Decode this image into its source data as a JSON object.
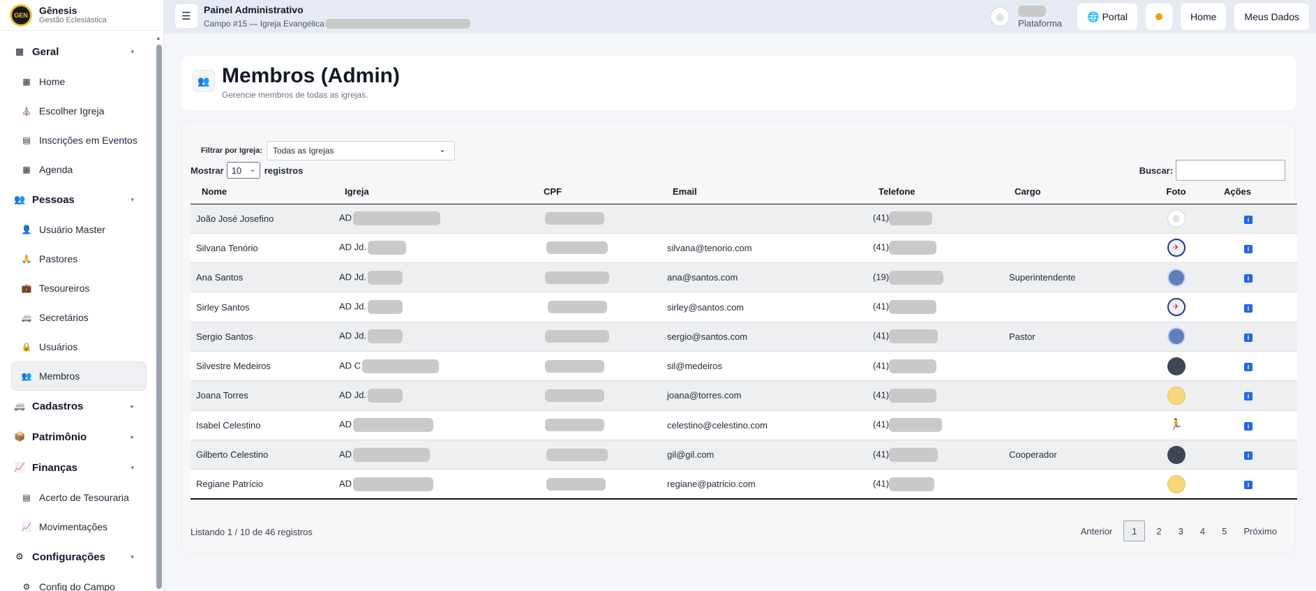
{
  "brand": {
    "name": "Gênesis",
    "subtitle": "Gestão Eclesiástica",
    "logo_text": "GEN"
  },
  "sidebar": {
    "sections": [
      {
        "label": "Geral",
        "icon": "grid-icon",
        "glyph": "▦",
        "caret": "▾",
        "items": [
          {
            "label": "Home",
            "icon": "grid-icon",
            "glyph": "▦"
          },
          {
            "label": "Escolher Igreja",
            "icon": "church-icon",
            "glyph": "⛪"
          },
          {
            "label": "Inscrições em Eventos",
            "icon": "document-icon",
            "glyph": "▤"
          },
          {
            "label": "Agenda",
            "icon": "calendar-icon",
            "glyph": "▦"
          }
        ]
      },
      {
        "label": "Pessoas",
        "icon": "people-icon",
        "glyph": "👥",
        "caret": "▾",
        "items": [
          {
            "label": "Usuário Master",
            "icon": "user-icon",
            "glyph": "👤"
          },
          {
            "label": "Pastores",
            "icon": "pastor-icon",
            "glyph": "🙏"
          },
          {
            "label": "Tesoureiros",
            "icon": "briefcase-icon",
            "glyph": "💼"
          },
          {
            "label": "Secretários",
            "icon": "vehicle-icon",
            "glyph": "🚐"
          },
          {
            "label": "Usuários",
            "icon": "lock-icon",
            "glyph": "🔒"
          },
          {
            "label": "Membros",
            "icon": "people-icon",
            "glyph": "👥",
            "active": true
          }
        ]
      },
      {
        "label": "Cadastros",
        "icon": "vehicle-icon",
        "glyph": "🚐",
        "caret": "▸",
        "items": []
      },
      {
        "label": "Patrimônio",
        "icon": "box-icon",
        "glyph": "📦",
        "caret": "▸",
        "items": []
      },
      {
        "label": "Finanças",
        "icon": "chart-icon",
        "glyph": "📈",
        "caret": "▾",
        "items": [
          {
            "label": "Acerto de Tesouraria",
            "icon": "document-icon",
            "glyph": "▤"
          },
          {
            "label": "Movimentações",
            "icon": "chart-icon",
            "glyph": "📈"
          }
        ]
      },
      {
        "label": "Configurações",
        "icon": "gear-icon",
        "glyph": "⚙",
        "caret": "▾",
        "items": [
          {
            "label": "Config do Campo",
            "icon": "gear-icon",
            "glyph": "⚙"
          }
        ]
      }
    ]
  },
  "topbar": {
    "title": "Painel Administrativo",
    "subtitle": "Campo #15 — Igreja Evangélica",
    "platform_label": "Plataforma",
    "portal_label": "Portal",
    "home_label": "Home",
    "my_data_label": "Meus Dados"
  },
  "header": {
    "title": "Membros (Admin)",
    "subtitle": "Gerencie membros de todas as igrejas."
  },
  "filter": {
    "label": "Filtrar por Igreja:",
    "selected": "Todas as Igrejas"
  },
  "length": {
    "prefix": "Mostrar",
    "selected": "10",
    "suffix": "registros"
  },
  "search": {
    "label": "Buscar:"
  },
  "table": {
    "columns": [
      "Nome",
      "Igreja",
      "CPF",
      "Email",
      "Telefone",
      "Cargo",
      "Foto",
      "Ações"
    ],
    "rows": [
      {
        "nome": "João José Josefino",
        "igreja": "AD",
        "email": "",
        "tel": "(41)",
        "cargo": "",
        "photo": "camera",
        "photo_color": "#ffffff"
      },
      {
        "nome": "Silvana Tenório",
        "igreja": "AD Jd.",
        "email": "silvana@tenorio.com",
        "tel": "(41)",
        "cargo": "",
        "photo": "emblem",
        "photo_color": "#eef1f8"
      },
      {
        "nome": "Ana Santos",
        "igreja": "AD Jd.",
        "email": "ana@santos.com",
        "tel": "(19)",
        "cargo": "Superintendente",
        "photo": "seal",
        "photo_color": "#5f7fb8"
      },
      {
        "nome": "Sirley Santos",
        "igreja": "AD Jd.",
        "email": "sirley@santos.com",
        "tel": "(41)",
        "cargo": "",
        "photo": "emblem",
        "photo_color": "#eef1f8"
      },
      {
        "nome": "Sergio Santos",
        "igreja": "AD Jd.",
        "email": "sergio@santos.com",
        "tel": "(41)",
        "cargo": "Pastor",
        "photo": "seal",
        "photo_color": "#5f7fb8"
      },
      {
        "nome": "Silvestre Medeiros",
        "igreja": "AD C",
        "email": "sil@medeiros",
        "tel": "(41)",
        "cargo": "",
        "photo": "dark",
        "photo_color": "#3f4756"
      },
      {
        "nome": "Joana Torres",
        "igreja": "AD Jd.",
        "email": "joana@torres.com",
        "tel": "(41)",
        "cargo": "",
        "photo": "cartoon",
        "photo_color": "#f6d77a"
      },
      {
        "nome": "Isabel Celestino",
        "igreja": "AD",
        "email": "celestino@celestino.com",
        "tel": "(41)",
        "cargo": "",
        "photo": "figure",
        "photo_color": "#ffffff"
      },
      {
        "nome": "Gilberto Celestino",
        "igreja": "AD",
        "email": "gil@gil.com",
        "tel": "(41)",
        "cargo": "Cooperador",
        "photo": "dark",
        "photo_color": "#3f4756"
      },
      {
        "nome": "Regiane Patrício",
        "igreja": "AD",
        "email": "regiane@patricio.com",
        "tel": "(41)",
        "cargo": "",
        "photo": "cartoon",
        "photo_color": "#f6d77a"
      }
    ],
    "action_glyph": "i"
  },
  "footer": {
    "info": "Listando 1 / 10 de 46 registros",
    "pager": {
      "prev": "Anterior",
      "pages": [
        "1",
        "2",
        "3",
        "4",
        "5"
      ],
      "current": "1",
      "next": "Próximo"
    }
  }
}
